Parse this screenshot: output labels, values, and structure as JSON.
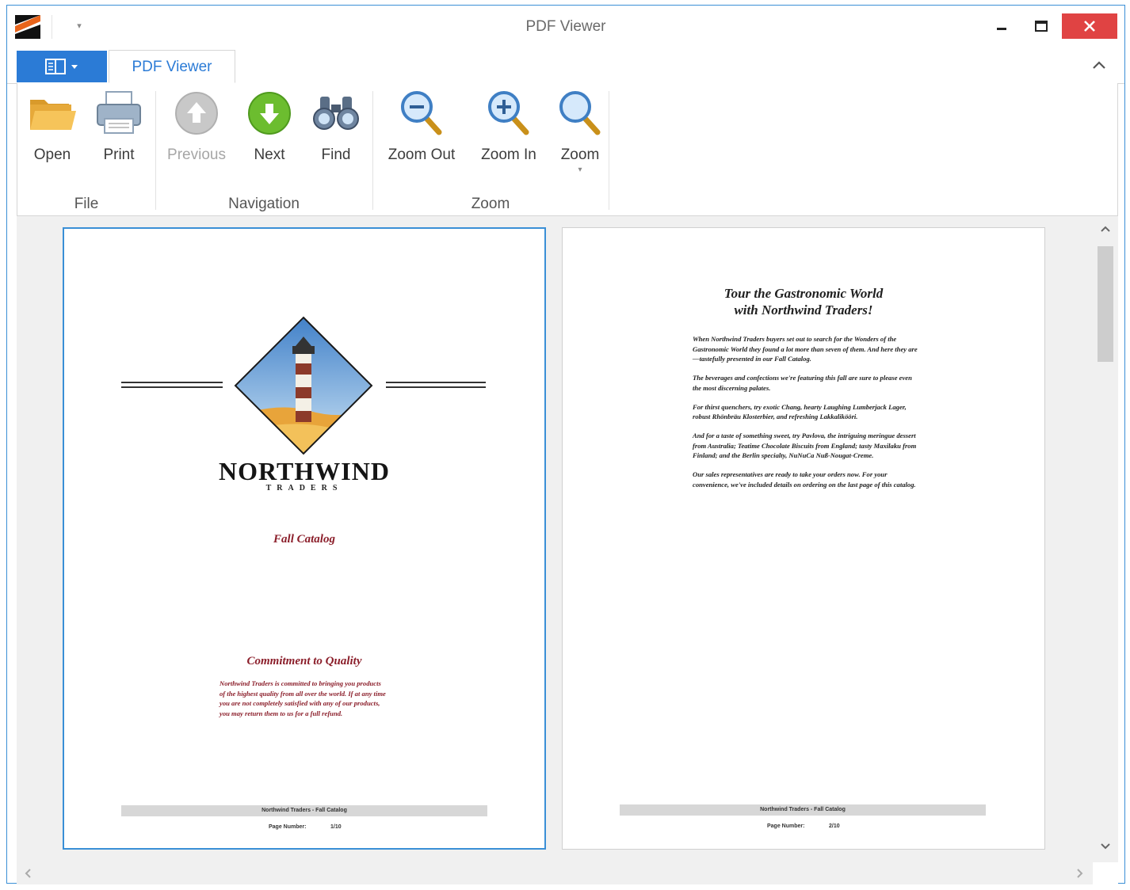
{
  "window": {
    "title": "PDF Viewer"
  },
  "ribbon": {
    "tab": "PDF Viewer",
    "groups": [
      {
        "label": "File",
        "buttons": [
          {
            "label": "Open",
            "icon": "folder-open-icon"
          },
          {
            "label": "Print",
            "icon": "printer-icon"
          }
        ]
      },
      {
        "label": "Navigation",
        "buttons": [
          {
            "label": "Previous",
            "icon": "arrow-up-circle-icon",
            "disabled": true
          },
          {
            "label": "Next",
            "icon": "arrow-down-circle-icon"
          },
          {
            "label": "Find",
            "icon": "binoculars-icon"
          }
        ]
      },
      {
        "label": "Zoom",
        "buttons": [
          {
            "label": "Zoom Out",
            "icon": "zoom-out-icon"
          },
          {
            "label": "Zoom In",
            "icon": "zoom-in-icon"
          },
          {
            "label": "Zoom",
            "icon": "magnifier-icon"
          }
        ]
      }
    ]
  },
  "document": {
    "page1": {
      "brand": "NORTHWIND",
      "brand_sub": "TRADERS",
      "subtitle": "Fall Catalog",
      "heading": "Commitment to Quality",
      "text": "Northwind Traders is committed to bringing you products of the highest quality from all over the world. If at any time you are not completely satisfied with any of our products, you may return them to us for a full refund.",
      "footer": "Northwind Traders - Fall Catalog",
      "page_label": "Page Number:",
      "page_value": "1/10"
    },
    "page2": {
      "title_line1": "Tour the Gastronomic World",
      "title_line2": "with Northwind Traders!",
      "paragraphs": [
        "When Northwind Traders buyers set out to search for the Wonders of the Gastronomic World they found a lot more than seven of them. And here they are—tastefully presented in our Fall Catalog.",
        "The beverages and confections we're featuring this fall are sure to please even the most discerning palates.",
        "For thirst quenchers, try exotic Chang, hearty Laughing Lumberjack Lager, robust Rhönbräu Klosterbier, and refreshing Lakkalikööri.",
        "And for a taste of something sweet, try Pavlova, the intriguing meringue dessert from Australia; Teatime Chocolate Biscuits from England; tasty Maxilaku from Finland; and the Berlin specialty, NuNuCa Nuß-Nougat-Creme.",
        "Our sales representatives are ready to take your orders now. For your convenience, we've included details on ordering on the last page of this catalog."
      ],
      "footer": "Northwind Traders - Fall Catalog",
      "page_label": "Page Number:",
      "page_value": "2/10"
    }
  },
  "colors": {
    "accent": "#2b7bd6",
    "close": "#e04343",
    "catalog_red": "#8b1e2a"
  }
}
